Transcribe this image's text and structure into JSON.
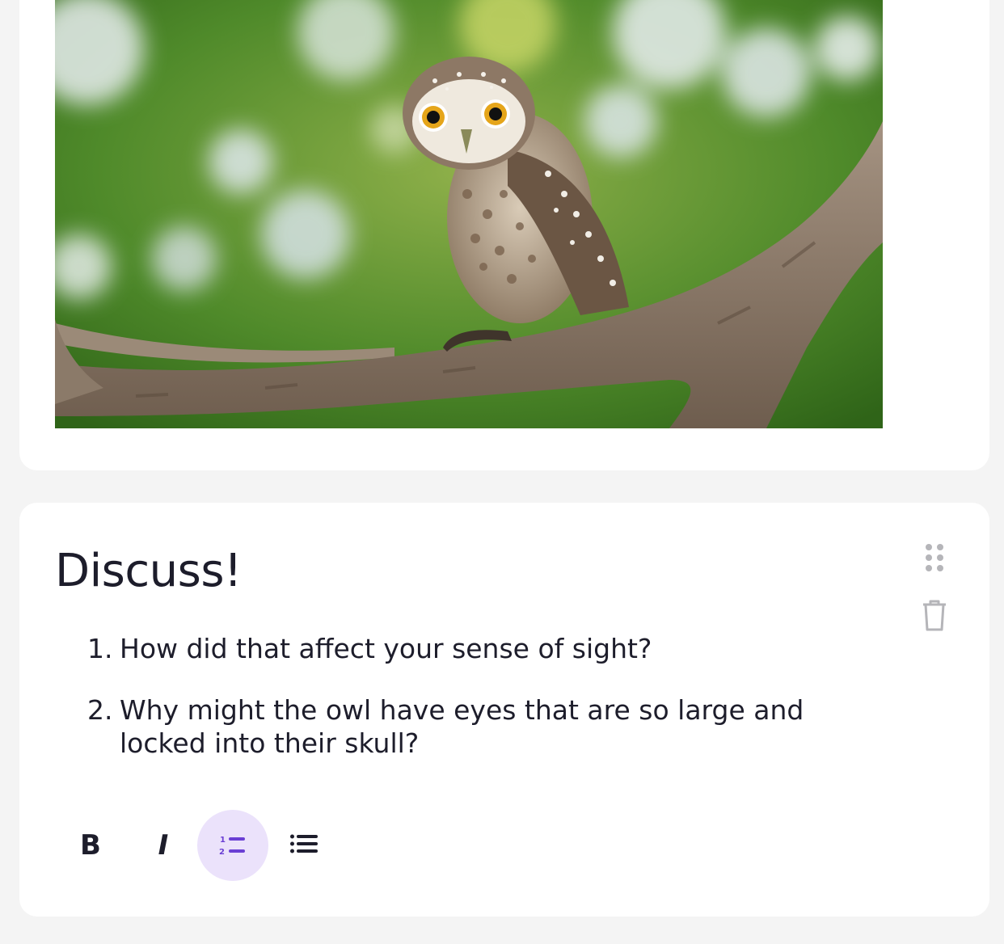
{
  "image_card": {
    "photo_alt": "Owl perched on a tree branch"
  },
  "discuss_card": {
    "title": "Discuss!",
    "questions": [
      {
        "number": "1.",
        "text": "How did that affect your sense of sight?"
      },
      {
        "number": "2.",
        "text": "Why might the owl have eyes that are so large and locked into their skull?"
      }
    ],
    "side_icons": [
      "drag-handle-icon",
      "trash-icon"
    ]
  },
  "toolbar": {
    "bold_label": "B",
    "italic_label": "I",
    "numbered_list_icon": "numbered-list-icon",
    "bullet_list_icon": "bullet-list-icon",
    "active_button": "numbered-list",
    "active_color": "#ebe2fb",
    "accent_color": "#6a3fd4"
  }
}
